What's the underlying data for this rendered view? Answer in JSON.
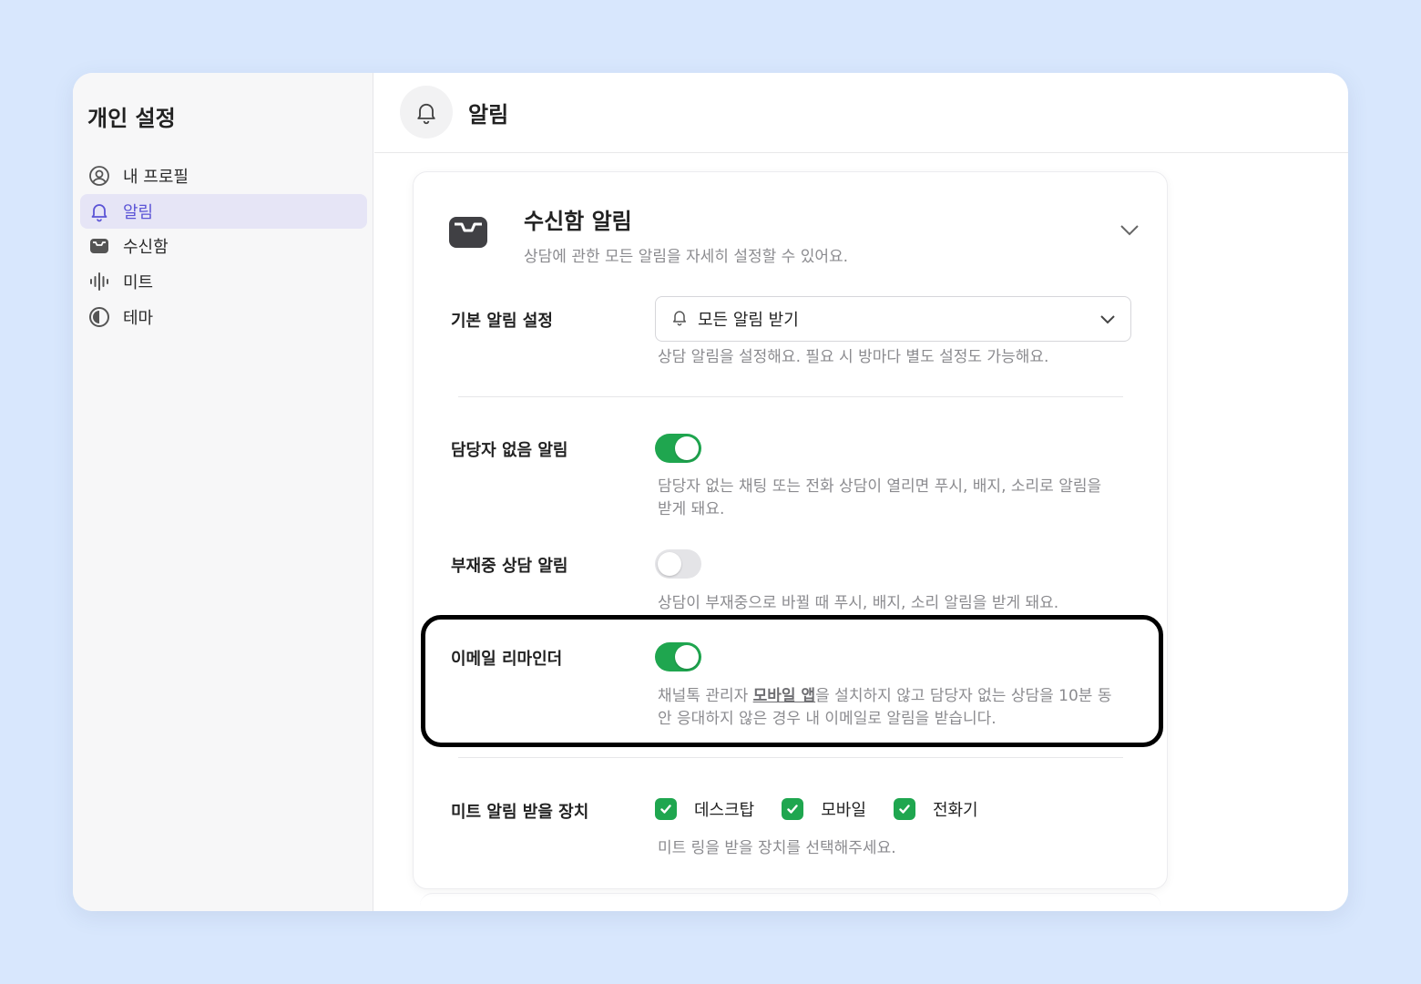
{
  "sidebar": {
    "title": "개인 설정",
    "items": [
      {
        "label": "내 프로필",
        "icon": "user-circle-icon",
        "active": false
      },
      {
        "label": "알림",
        "icon": "bell-icon",
        "active": true
      },
      {
        "label": "수신함",
        "icon": "inbox-icon",
        "active": false
      },
      {
        "label": "미트",
        "icon": "waveform-icon",
        "active": false
      },
      {
        "label": "테마",
        "icon": "contrast-icon",
        "active": false
      }
    ]
  },
  "header": {
    "title": "알림",
    "icon": "bell-icon"
  },
  "card": {
    "title": "수신함 알림",
    "subtitle": "상담에 관한 모든 알림을 자세히 설정할 수 있어요.",
    "default_setting": {
      "label": "기본 알림 설정",
      "selected": "모든 알림 받기",
      "desc": "상담 알림을 설정해요. 필요 시 방마다 별도 설정도 가능해요."
    },
    "unassigned": {
      "label": "담당자 없음 알림",
      "enabled": true,
      "desc_line1": "담당자 없는 채팅 또는 전화 상담이 열리면 푸시, 배지, 소리로 알림을",
      "desc_line2": "받게 돼요."
    },
    "away": {
      "label": "부재중 상담 알림",
      "enabled": false,
      "desc": "상담이 부재중으로 바뀔 때 푸시, 배지, 소리 알림을 받게 돼요."
    },
    "email_reminder": {
      "label": "이메일 리마인더",
      "enabled": true,
      "desc_pre": "채널톡 관리자 ",
      "desc_link": "모바일 앱",
      "desc_post": "을 설치하지 않고 담당자 없는 상담을 10분 동",
      "desc_line2": "안 응대하지 않은 경우 내 이메일로 알림을 받습니다."
    },
    "meet_devices": {
      "label": "미트 알림 받을 장치",
      "options": [
        {
          "label": "데스크탑",
          "checked": true
        },
        {
          "label": "모바일",
          "checked": true
        },
        {
          "label": "전화기",
          "checked": true
        }
      ],
      "desc": "미트 링을 받을 장치를 선택해주세요."
    }
  },
  "colors": {
    "accent": "#5b54d6",
    "toggle_on": "#1fa64f",
    "background": "#d8e7fd"
  }
}
